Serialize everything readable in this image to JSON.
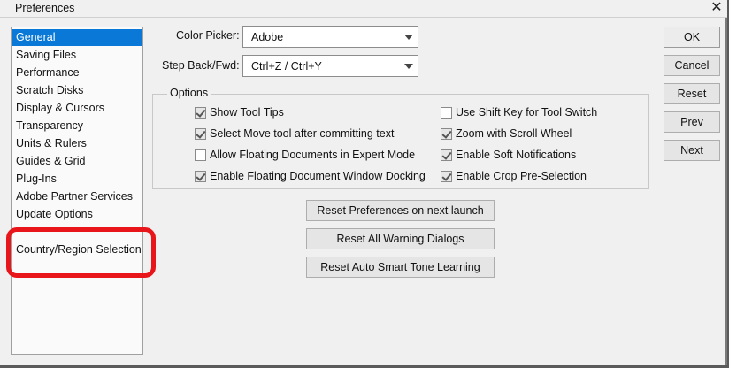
{
  "window": {
    "title": "Preferences"
  },
  "sidebar": {
    "items": [
      {
        "label": "General"
      },
      {
        "label": "Saving Files"
      },
      {
        "label": "Performance"
      },
      {
        "label": "Scratch Disks"
      },
      {
        "label": "Display & Cursors"
      },
      {
        "label": "Transparency"
      },
      {
        "label": "Units & Rulers"
      },
      {
        "label": "Guides & Grid"
      },
      {
        "label": "Plug-Ins"
      },
      {
        "label": "Adobe Partner Services"
      },
      {
        "label": "Update Options"
      },
      {
        "label": "Country/Region Selection"
      }
    ],
    "selected": "General",
    "highlight_color": "#e8161b",
    "selected_color": "#0a78d7"
  },
  "color_picker": {
    "label": "Color Picker:",
    "value": "Adobe"
  },
  "step_back": {
    "label": "Step Back/Fwd:",
    "value": "Ctrl+Z / Ctrl+Y"
  },
  "options": {
    "title": "Options",
    "left": [
      {
        "label": "Show Tool Tips",
        "checked": true
      },
      {
        "label": "Select Move tool after committing text",
        "checked": true
      },
      {
        "label": "Allow Floating Documents in Expert Mode",
        "checked": false
      },
      {
        "label": "Enable Floating Document Window Docking",
        "checked": true
      }
    ],
    "right": [
      {
        "label": "Use Shift Key for Tool Switch",
        "checked": false
      },
      {
        "label": "Zoom with Scroll Wheel",
        "checked": true
      },
      {
        "label": "Enable Soft Notifications",
        "checked": true
      },
      {
        "label": "Enable Crop Pre-Selection",
        "checked": true
      }
    ]
  },
  "center_buttons": {
    "reset_prefs": "Reset Preferences on next launch",
    "reset_warnings": "Reset All Warning Dialogs",
    "reset_smart_tone": "Reset Auto Smart Tone Learning"
  },
  "right_buttons": {
    "ok": "OK",
    "cancel": "Cancel",
    "reset": "Reset",
    "prev": "Prev",
    "next": "Next"
  }
}
